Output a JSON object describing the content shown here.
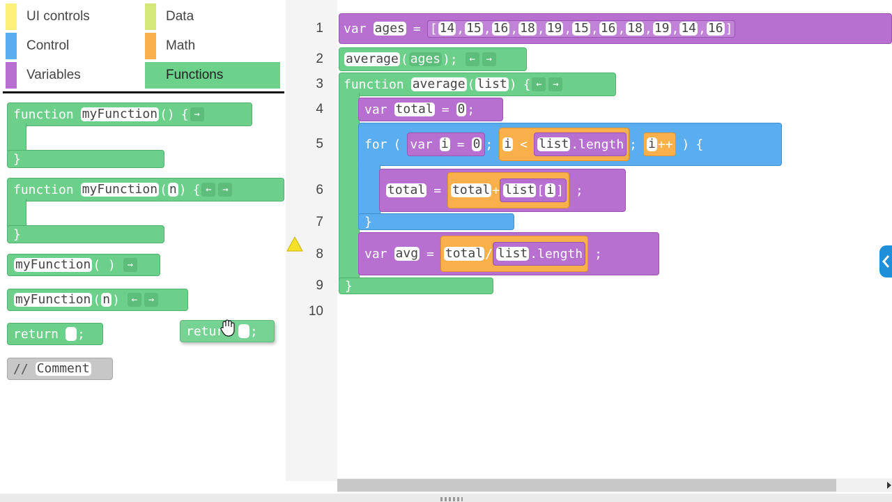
{
  "palette": {
    "categories": [
      {
        "label": "UI controls",
        "color": "#fff07a"
      },
      {
        "label": "Control",
        "color": "#5aaef0"
      },
      {
        "label": "Variables",
        "color": "#b76fd0"
      },
      {
        "label": "Data",
        "color": "#d3e876"
      },
      {
        "label": "Math",
        "color": "#f9b04a"
      },
      {
        "label": "Functions",
        "color": "#6bd18b"
      }
    ],
    "blocks": {
      "func_kw": "function",
      "func_name": "myFunction",
      "func_parens": "()",
      "brace_open": "{",
      "brace_close": "}",
      "param_open": "(",
      "param_n": "n",
      "param_close": ")",
      "call_parens": "( )",
      "return_kw": "return",
      "semi": ";",
      "comment_prefix": "//",
      "comment_text": "Comment"
    }
  },
  "drag_block": {
    "return_kw": "return",
    "semi": ";"
  },
  "editor": {
    "line_numbers": [
      "1",
      "2",
      "3",
      "4",
      "5",
      "6",
      "7",
      "8",
      "9",
      "10"
    ],
    "line1": {
      "var_kw": "var",
      "name": "ages",
      "eq": "=",
      "lb": "[",
      "values": [
        "14",
        "15",
        "16",
        "18",
        "19",
        "15",
        "16",
        "18",
        "19",
        "14",
        "16"
      ],
      "rb": "]"
    },
    "line2": {
      "fn": "average",
      "lp": "(",
      "arg": "ages",
      "rp": ")",
      "semi": ";"
    },
    "line3": {
      "kw": "function",
      "fn": "average",
      "lp": "(",
      "param": "list",
      "rp": ")",
      "brace": "{"
    },
    "line4": {
      "var_kw": "var",
      "name": "total",
      "eq": "=",
      "val": "0",
      "semi": ";"
    },
    "line5": {
      "for_kw": "for",
      "lp": "(",
      "var_kw": "var",
      "i": "i",
      "eq": "=",
      "zero": "0",
      "semi1": ";",
      "i2": "i",
      "lt": "<",
      "list": "list",
      "length": ".length",
      "semi2": ";",
      "i3": "i",
      "inc": "++",
      "rp": ")",
      "brace": "{"
    },
    "line6": {
      "name": "total",
      "eq": "=",
      "total": "total",
      "plus": "+",
      "list": "list",
      "lb": "[",
      "i": "i",
      "rb": "]",
      "semi": ";"
    },
    "line7": {
      "brace": "}"
    },
    "line8": {
      "var_kw": "var",
      "name": "avg",
      "eq": "=",
      "total": "total",
      "div": "/",
      "list": "list",
      "length": ".length",
      "semi": ";"
    },
    "line9": {
      "brace": "}"
    },
    "arrows": {
      "left": "←",
      "right": "→"
    }
  }
}
